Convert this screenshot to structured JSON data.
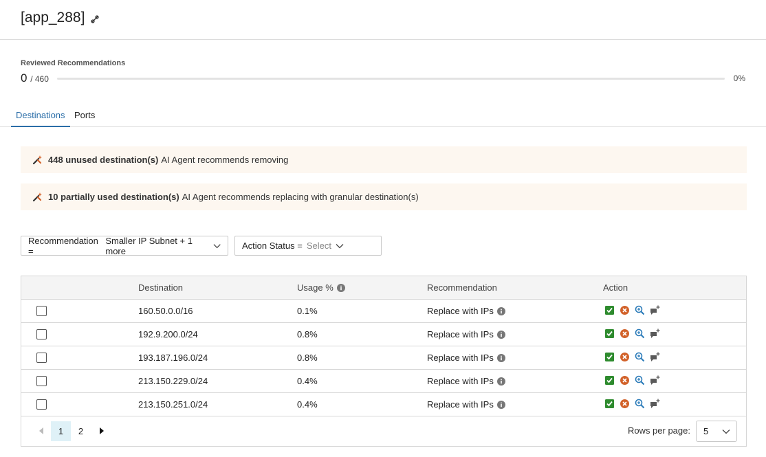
{
  "header": {
    "title": "[app_288]",
    "edit_icon": "edit-link-icon"
  },
  "progress": {
    "label": "Reviewed Recommendations",
    "reviewed": "0",
    "total": "/ 460",
    "percent_label": "0%",
    "fraction": 0
  },
  "tabs": [
    {
      "label": "Destinations",
      "active": true
    },
    {
      "label": "Ports",
      "active": false
    }
  ],
  "banners": [
    {
      "count": "448 unused destination(s)",
      "text": "AI Agent recommends removing",
      "icon": "ai-agent-icon"
    },
    {
      "count": "10 partially used destination(s)",
      "text": "AI Agent recommends replacing with granular destination(s)",
      "icon": "ai-agent-icon"
    }
  ],
  "filters": [
    {
      "label": "Recommendation =",
      "value": "Smaller IP Subnet + 1 more"
    },
    {
      "label": "Action Status =",
      "value": "Select"
    }
  ],
  "table": {
    "headers": {
      "destination": "Destination",
      "usage": "Usage %",
      "recommendation": "Recommendation",
      "action": "Action"
    },
    "rows": [
      {
        "destination": "160.50.0.0/16",
        "usage": "0.1%",
        "recommendation": "Replace with IPs"
      },
      {
        "destination": "192.9.200.0/24",
        "usage": "0.8%",
        "recommendation": "Replace with IPs"
      },
      {
        "destination": "193.187.196.0/24",
        "usage": "0.8%",
        "recommendation": "Replace with IPs"
      },
      {
        "destination": "213.150.229.0/24",
        "usage": "0.4%",
        "recommendation": "Replace with IPs"
      },
      {
        "destination": "213.150.251.0/24",
        "usage": "0.4%",
        "recommendation": "Replace with IPs"
      }
    ]
  },
  "pagination": {
    "pages": [
      "1",
      "2"
    ],
    "current": "1",
    "rows_per_page_label": "Rows per page:",
    "rows_per_page": "5"
  },
  "colors": {
    "accent": "#2b6ea8",
    "banner_bg": "#fdf7f0",
    "accept_green": "#2e8b2e",
    "reject_orange": "#d2622a",
    "zoom_blue": "#2b7bb9",
    "comment_gray": "#5a5a5a"
  }
}
